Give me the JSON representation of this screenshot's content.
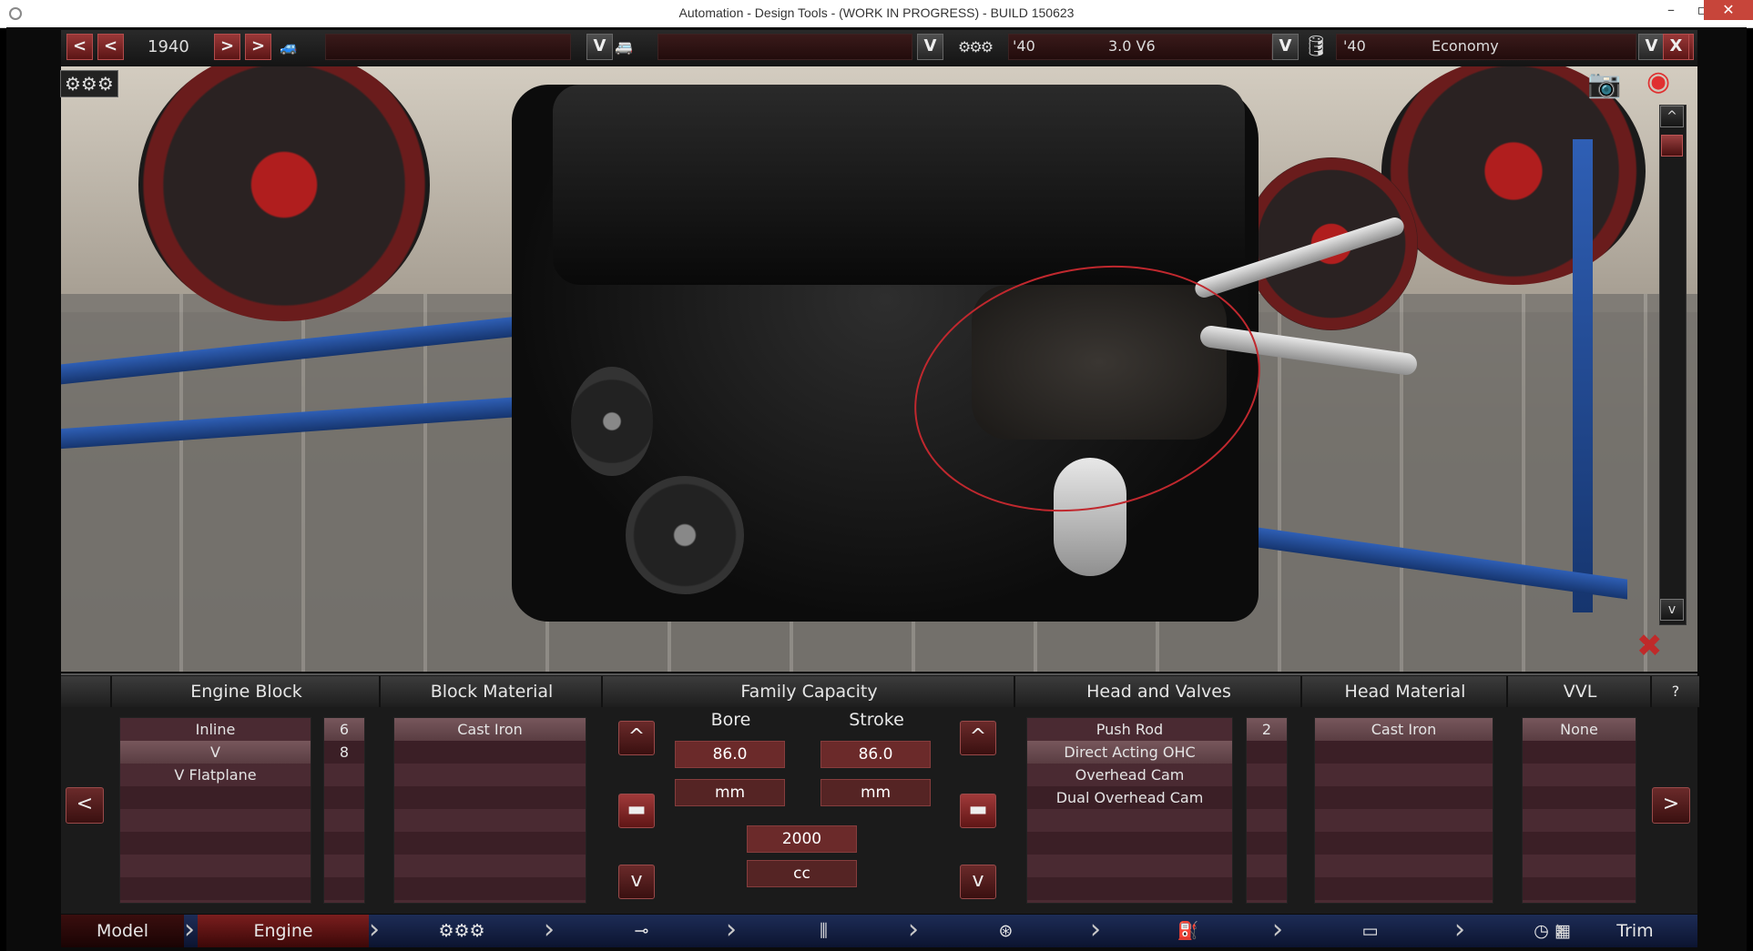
{
  "window": {
    "title": "Automation - Design Tools - (WORK IN PROGRESS) - BUILD 150623"
  },
  "toolbar": {
    "year": "1940",
    "btn_prev_prev": "<",
    "btn_prev": "<",
    "btn_next": ">",
    "btn_next_next": ">",
    "dropdown_arrow": "V",
    "engine_year": "'40",
    "engine_name": "3.0 V6",
    "variant_year": "'40",
    "variant_name": "Economy",
    "close_label": "X"
  },
  "panel": {
    "engine_block": {
      "title": "Engine Block",
      "options": [
        "Inline",
        "V",
        "V Flatplane"
      ],
      "selected": "V",
      "cylinders": [
        "6",
        "8"
      ]
    },
    "block_material": {
      "title": "Block Material",
      "options": [
        "Cast Iron"
      ]
    },
    "family_capacity": {
      "title": "Family Capacity",
      "bore_label": "Bore",
      "bore_value": "86.0",
      "bore_unit": "mm",
      "stroke_label": "Stroke",
      "stroke_value": "86.0",
      "stroke_unit": "mm",
      "capacity_value": "2000",
      "capacity_unit": "cc",
      "up_label": "^",
      "down_label": "v"
    },
    "head_valves": {
      "title": "Head and Valves",
      "options": [
        "Push Rod",
        "Direct Acting OHC",
        "Overhead Cam",
        "Dual Overhead Cam"
      ],
      "selected": "Direct Acting OHC",
      "valves": [
        "2"
      ]
    },
    "head_material": {
      "title": "Head Material",
      "options": [
        "Cast Iron"
      ]
    },
    "vvl": {
      "title": "VVL",
      "options": [
        "None"
      ]
    },
    "help": "?",
    "prev_label": "<",
    "next_label": ">"
  },
  "nav": {
    "items": [
      "Model",
      "Engine",
      "Trim"
    ],
    "active": "Engine"
  },
  "scroll": {
    "up": "^",
    "down": "v"
  }
}
